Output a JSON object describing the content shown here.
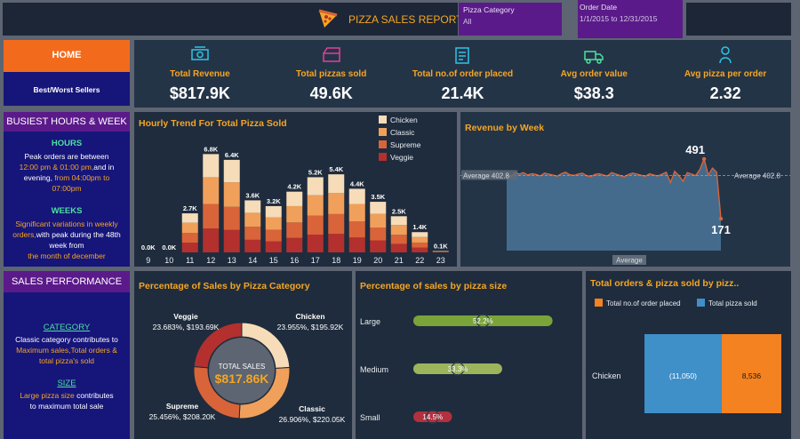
{
  "header": {
    "title": "PIZZA SALES REPORT",
    "filter_category_label": "Pizza Category",
    "filter_category_value": "All",
    "filter_date_label": "Order Date",
    "filter_date_value": "1/1/2015 to 12/31/2015"
  },
  "nav": {
    "home": "HOME",
    "best_worst": "Best/Worst Sellers"
  },
  "kpis": [
    {
      "title": "Total Revenue",
      "value": "$817.9K",
      "icon": "money-icon"
    },
    {
      "title": "Total pizzas sold",
      "value": "49.6K",
      "icon": "pizza-box-icon"
    },
    {
      "title": "Total no.of order placed",
      "value": "21.4K",
      "icon": "clipboard-icon"
    },
    {
      "title": "Avg order value",
      "value": "$38.3",
      "icon": "delivery-icon"
    },
    {
      "title": "Avg pizza per order",
      "value": "2.32",
      "icon": "chef-icon"
    }
  ],
  "busiest": {
    "header": "BUSIEST HOURS & WEEK",
    "hours_title": "HOURS",
    "hours_l1": "Peak orders are between",
    "hours_l2a": "12:00 pm & 01:00 pm,",
    "hours_l2b": "and in",
    "hours_l3a": "evening, ",
    "hours_l3b": "from 04:00pm to",
    "hours_l4": "07:00pm",
    "weeks_title": "WEEKS",
    "weeks_l1": "Significant variations in weekly",
    "weeks_l2a": "orders,",
    "weeks_l2b": "with peak during the 48th",
    "weeks_l3": "week from",
    "weeks_l4": "the month of december"
  },
  "sales_perf": {
    "header": "SALES PERFORMANCE",
    "category_title": "CATEGORY",
    "cat_l1": "Classic category contributes to",
    "cat_l2": "Maximum sales,Total orders &",
    "cat_l3": "total pizza's sold",
    "size_title": "SIZE",
    "size_l1a": "Large pizza size",
    "size_l1b": " contributes",
    "size_l2": "to maximum total sale"
  },
  "colors": {
    "Chicken": "#f6dcb9",
    "Classic": "#f0a05a",
    "Supreme": "#d9643a",
    "Veggie": "#b3302e",
    "accent": "#f5a623",
    "purple": "#5b1a8a",
    "navy": "#16157a"
  },
  "chart_data": [
    {
      "type": "bar",
      "title": "Hourly Trend For Total Pizza Sold",
      "categories": [
        "9",
        "10",
        "11",
        "12",
        "13",
        "14",
        "15",
        "16",
        "17",
        "18",
        "19",
        "20",
        "21",
        "22",
        "23"
      ],
      "totals": [
        0.0,
        0.0,
        2.7,
        6.8,
        6.4,
        3.6,
        3.2,
        4.2,
        5.2,
        5.4,
        4.4,
        3.5,
        2.5,
        1.4,
        0.1
      ],
      "total_labels": [
        "0.0K",
        "0.0K",
        "2.7K",
        "6.8K",
        "6.4K",
        "3.6K",
        "3.2K",
        "4.2K",
        "5.2K",
        "5.4K",
        "4.4K",
        "3.5K",
        "2.5K",
        "1.4K",
        "0.1K"
      ],
      "stacked": true,
      "series": [
        {
          "name": "Chicken",
          "values": [
            0.0,
            0.0,
            0.65,
            1.6,
            1.55,
            0.86,
            0.77,
            1.0,
            1.25,
            1.3,
            1.05,
            0.84,
            0.6,
            0.34,
            0.02
          ]
        },
        {
          "name": "Classic",
          "values": [
            0.0,
            0.0,
            0.7,
            1.85,
            1.7,
            0.97,
            0.86,
            1.13,
            1.4,
            1.45,
            1.2,
            0.94,
            0.68,
            0.38,
            0.03
          ]
        },
        {
          "name": "Supreme",
          "values": [
            0.0,
            0.0,
            0.68,
            1.7,
            1.6,
            0.9,
            0.81,
            1.07,
            1.32,
            1.37,
            1.12,
            0.89,
            0.63,
            0.35,
            0.03
          ]
        },
        {
          "name": "Veggie",
          "values": [
            0.0,
            0.0,
            0.67,
            1.65,
            1.55,
            0.87,
            0.76,
            1.0,
            1.23,
            1.28,
            1.03,
            0.83,
            0.59,
            0.33,
            0.02
          ]
        }
      ],
      "legend": [
        "Chicken",
        "Classic",
        "Supreme",
        "Veggie"
      ]
    },
    {
      "type": "area",
      "title": "Revenue by Week",
      "reference_label": "Average",
      "reference_value": 402.8,
      "reference_text": "Average 402.8",
      "max_label": "491",
      "min_label": "171",
      "ylim": [
        0,
        600
      ],
      "values": [
        402,
        395,
        420,
        410,
        418,
        405,
        412,
        408,
        400,
        415,
        410,
        405,
        398,
        412,
        420,
        407,
        403,
        410,
        415,
        402,
        396,
        408,
        412,
        405,
        400,
        418,
        410,
        402,
        395,
        408,
        415,
        410,
        404,
        398,
        412,
        405,
        400,
        410,
        420,
        365,
        425,
        402,
        372,
        418,
        410,
        402,
        435,
        491,
        405,
        442,
        420,
        171
      ]
    },
    {
      "type": "pie",
      "title": "Percentage of Sales by Pizza Category",
      "center_label": "TOTAL SALES",
      "center_value": "$817.86K",
      "slices": [
        {
          "name": "Chicken",
          "pct": 23.955,
          "label": "23.955%, $195.92K"
        },
        {
          "name": "Classic",
          "pct": 26.906,
          "label": "26.906%, $220.05K"
        },
        {
          "name": "Supreme",
          "pct": 25.456,
          "label": "25.456%, $208.20K"
        },
        {
          "name": "Veggie",
          "pct": 23.683,
          "label": "23.683%, $193.69K"
        }
      ]
    },
    {
      "type": "bar",
      "title": "Percentage of sales by pizza size",
      "categories": [
        "Large",
        "Medium",
        "Small"
      ],
      "values": [
        52.2,
        33.3,
        14.5
      ],
      "value_labels": [
        "52.2%",
        "33.3%",
        "14.5%"
      ]
    },
    {
      "type": "bar",
      "title": "Total orders & pizza sold by pizz..",
      "legend": [
        "Total no.of order placed",
        "Total pizza sold"
      ],
      "category": "Chicken",
      "pizza_sold": 11050,
      "pizza_sold_label": "(11,050)",
      "orders": 8536,
      "orders_label": "8,536"
    }
  ]
}
